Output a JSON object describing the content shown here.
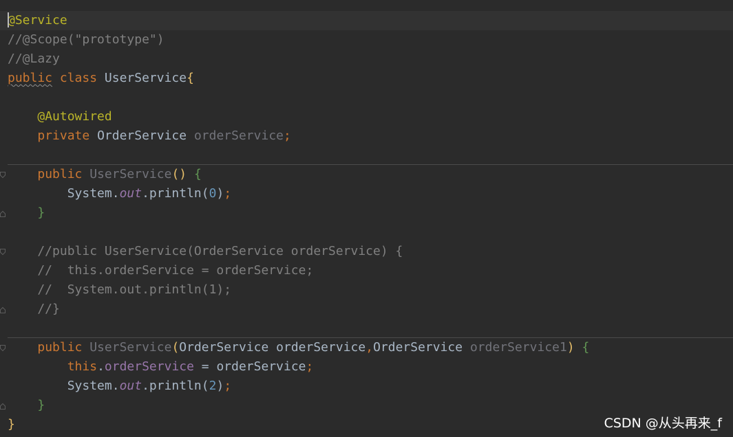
{
  "editor": {
    "lines": [
      {
        "tokens": [
          {
            "t": "@Service",
            "c": "ann"
          }
        ]
      },
      {
        "tokens": [
          {
            "t": "//@Scope(\"prototype\")",
            "c": "cmt"
          }
        ]
      },
      {
        "tokens": [
          {
            "t": "//@Lazy",
            "c": "cmt"
          }
        ]
      },
      {
        "tokens": [
          {
            "t": "public",
            "c": "kw"
          },
          {
            "t": " class ",
            "c": "kw"
          },
          {
            "t": "UserService",
            "c": "plain"
          },
          {
            "t": "{",
            "c": "brace"
          }
        ]
      },
      {
        "tokens": []
      },
      {
        "tokens": [
          {
            "t": "    ",
            "c": "plain"
          },
          {
            "t": "@Autowired",
            "c": "ann"
          }
        ]
      },
      {
        "tokens": [
          {
            "t": "    ",
            "c": "plain"
          },
          {
            "t": "private ",
            "c": "kw"
          },
          {
            "t": "OrderService ",
            "c": "plain"
          },
          {
            "t": "orderService",
            "c": "unused"
          },
          {
            "t": ";",
            "c": "kw"
          }
        ]
      },
      {
        "tokens": []
      },
      {
        "tokens": [
          {
            "t": "    ",
            "c": "plain"
          },
          {
            "t": "public ",
            "c": "kw"
          },
          {
            "t": "UserService",
            "c": "unused"
          },
          {
            "t": "()",
            "c": "brace"
          },
          {
            "t": " ",
            "c": "plain"
          },
          {
            "t": "{",
            "c": "brace2"
          }
        ]
      },
      {
        "tokens": [
          {
            "t": "        System.",
            "c": "plain"
          },
          {
            "t": "out",
            "c": "static"
          },
          {
            "t": ".println(",
            "c": "plain"
          },
          {
            "t": "0",
            "c": "num"
          },
          {
            "t": ")",
            "c": "plain"
          },
          {
            "t": ";",
            "c": "kw"
          }
        ]
      },
      {
        "tokens": [
          {
            "t": "    ",
            "c": "plain"
          },
          {
            "t": "}",
            "c": "brace2"
          }
        ]
      },
      {
        "tokens": []
      },
      {
        "tokens": [
          {
            "t": "    //public UserService(OrderService orderService) {",
            "c": "cmt"
          }
        ]
      },
      {
        "tokens": [
          {
            "t": "    //  this.orderService = orderService;",
            "c": "cmt"
          }
        ]
      },
      {
        "tokens": [
          {
            "t": "    //  System.out.println(1);",
            "c": "cmt"
          }
        ]
      },
      {
        "tokens": [
          {
            "t": "    //}",
            "c": "cmt"
          }
        ]
      },
      {
        "tokens": []
      },
      {
        "tokens": [
          {
            "t": "    ",
            "c": "plain"
          },
          {
            "t": "public ",
            "c": "kw"
          },
          {
            "t": "UserService",
            "c": "unused"
          },
          {
            "t": "(",
            "c": "brace"
          },
          {
            "t": "OrderService orderService",
            "c": "plain"
          },
          {
            "t": ",",
            "c": "kw"
          },
          {
            "t": "OrderService ",
            "c": "plain"
          },
          {
            "t": "orderService1",
            "c": "unused"
          },
          {
            "t": ")",
            "c": "brace"
          },
          {
            "t": " ",
            "c": "plain"
          },
          {
            "t": "{",
            "c": "brace2"
          }
        ]
      },
      {
        "tokens": [
          {
            "t": "        ",
            "c": "plain"
          },
          {
            "t": "this",
            "c": "kw"
          },
          {
            "t": ".",
            "c": "plain"
          },
          {
            "t": "orderService",
            "c": "field"
          },
          {
            "t": " = orderService",
            "c": "plain"
          },
          {
            "t": ";",
            "c": "kw"
          }
        ]
      },
      {
        "tokens": [
          {
            "t": "        System.",
            "c": "plain"
          },
          {
            "t": "out",
            "c": "static"
          },
          {
            "t": ".println(",
            "c": "plain"
          },
          {
            "t": "2",
            "c": "num"
          },
          {
            "t": ")",
            "c": "plain"
          },
          {
            "t": ";",
            "c": "kw"
          }
        ]
      },
      {
        "tokens": [
          {
            "t": "    ",
            "c": "plain"
          },
          {
            "t": "}",
            "c": "brace2"
          }
        ]
      },
      {
        "tokens": [
          {
            "t": "}",
            "c": "brace"
          }
        ]
      }
    ]
  },
  "watermark": "CSDN @从头再来_f",
  "colors": {
    "background": "#2b2b2b",
    "current_line": "#323232",
    "annotation": "#bbb529",
    "keyword": "#cc7832",
    "comment": "#808080",
    "plain": "#a9b7c6",
    "unused": "#72737a",
    "field": "#9876aa",
    "number": "#6897bb"
  }
}
